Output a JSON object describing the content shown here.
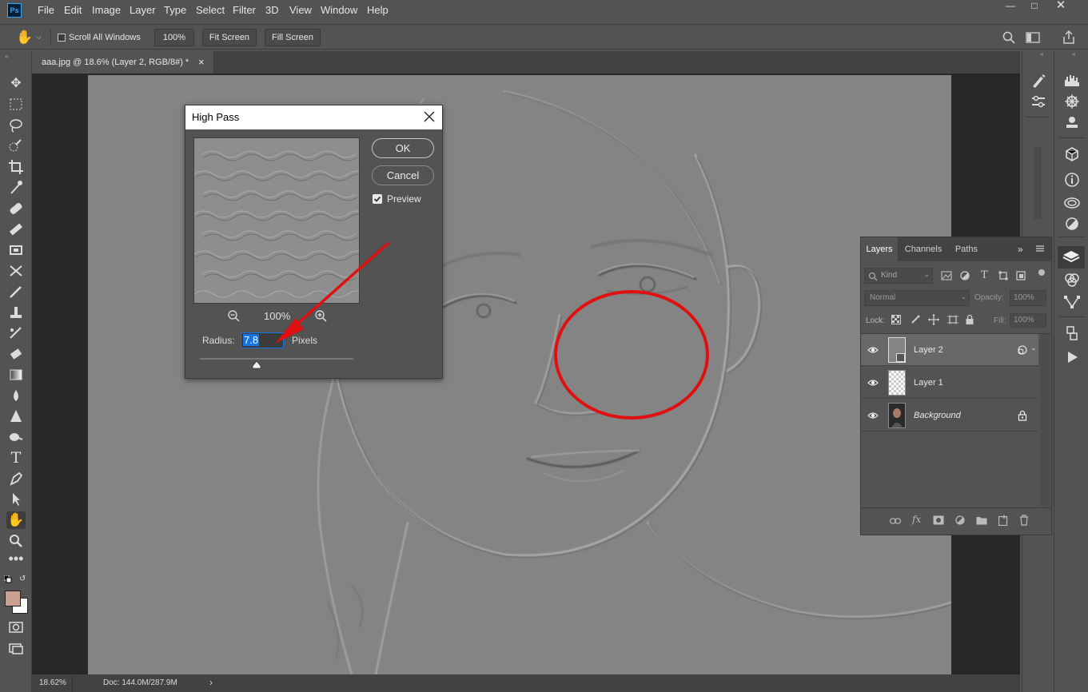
{
  "app": {
    "logo": "Ps",
    "menus": [
      "File",
      "Edit",
      "Image",
      "Layer",
      "Type",
      "Select",
      "Filter",
      "3D",
      "View",
      "Window",
      "Help"
    ],
    "window_controls": [
      "minimize-icon",
      "restore-icon",
      "close-icon"
    ]
  },
  "options_bar": {
    "scroll_all_label": "Scroll All Windows",
    "scroll_all_checked": false,
    "zoom_100_label": "100%",
    "fit_screen_label": "Fit Screen",
    "fill_screen_label": "Fill Screen"
  },
  "document": {
    "tab_title": "aaa.jpg @ 18.6% (Layer 2, RGB/8#) *",
    "tab_close": "×"
  },
  "dialog": {
    "title": "High Pass",
    "ok_label": "OK",
    "cancel_label": "Cancel",
    "preview_label": "Preview",
    "preview_checked": true,
    "zoom_level": "100%",
    "radius_label": "Radius:",
    "radius_value": "7.8",
    "radius_unit": "Pixels",
    "slider_level": 0.37
  },
  "layers_panel": {
    "tabs": [
      "Layers",
      "Channels",
      "Paths"
    ],
    "active_tab": "Layers",
    "filter_placeholder": "Kind",
    "blend_mode": "Normal",
    "opacity_label": "Opacity:",
    "opacity_value": "100%",
    "lock_label": "Lock:",
    "fill_label": "Fill:",
    "fill_value": "100%",
    "layers": [
      {
        "name": "Layer 2",
        "selected": true,
        "locked": false,
        "italic": false
      },
      {
        "name": "Layer 1",
        "selected": false,
        "locked": false,
        "italic": false
      },
      {
        "name": "Background",
        "selected": false,
        "locked": true,
        "italic": true
      }
    ]
  },
  "status": {
    "zoom": "18.62%",
    "doc_size": "Doc: 144.0M/287.9M"
  },
  "colors": {
    "foreground": "#c9a091",
    "background": "#ffffff",
    "annotation_red": "#e01010",
    "accent_blue": "#1473e6"
  }
}
